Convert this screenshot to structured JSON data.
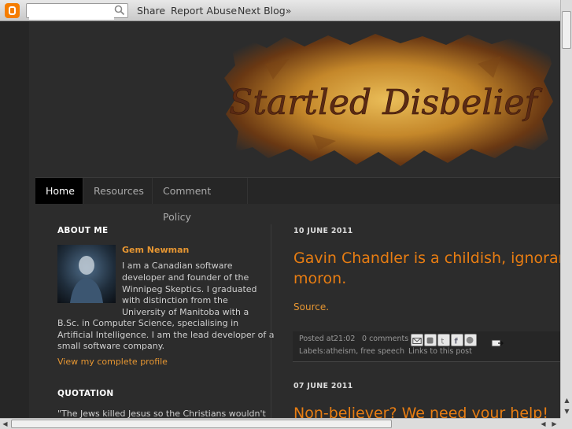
{
  "navbar": {
    "search_placeholder": "",
    "share": "Share",
    "report_abuse": "Report Abuse",
    "next_blog": "Next Blog»"
  },
  "blog": {
    "title": "Startled Disbelief"
  },
  "tabs": [
    {
      "label": "Home",
      "active": true
    },
    {
      "label": "Resources",
      "active": false
    },
    {
      "label": "Comment Policy",
      "active": false
    }
  ],
  "sidebar": {
    "about_title": "ABOUT ME",
    "name": "Gem Newman",
    "bio_lines_right": [
      "I am a Canadian software",
      "developer and founder of the",
      "Winnipeg Skeptics. I graduated",
      "with distinction from the",
      "University of Manitoba with a"
    ],
    "bio_lines_full": [
      "B.Sc. in Computer Science, specialising in",
      "Artificial Intelligence. I am the lead developer of a",
      "small software company."
    ],
    "profile_link": "View my complete profile",
    "quotation_title": "QUOTATION",
    "quotation_text": "\"The Jews killed Jesus so the Christians wouldn't"
  },
  "posts": [
    {
      "date": "10 JUNE 2011",
      "title_lines": [
        "Gavin Chandler is a childish, ignorant, h",
        "moron."
      ],
      "source_link": "Source.",
      "posted_at_label": "Posted at",
      "time": "21:02",
      "comments": "0 comments",
      "labels_label": "Labels:",
      "labels": "atheism, free speech",
      "permalink": "Links to this post"
    },
    {
      "date": "07 JUNE 2011",
      "title_lines": [
        "Non-believer? We need your help!"
      ]
    }
  ],
  "colors": {
    "accent": "#e87d12",
    "background": "#2c2c2c",
    "tab_active": "#000000"
  }
}
